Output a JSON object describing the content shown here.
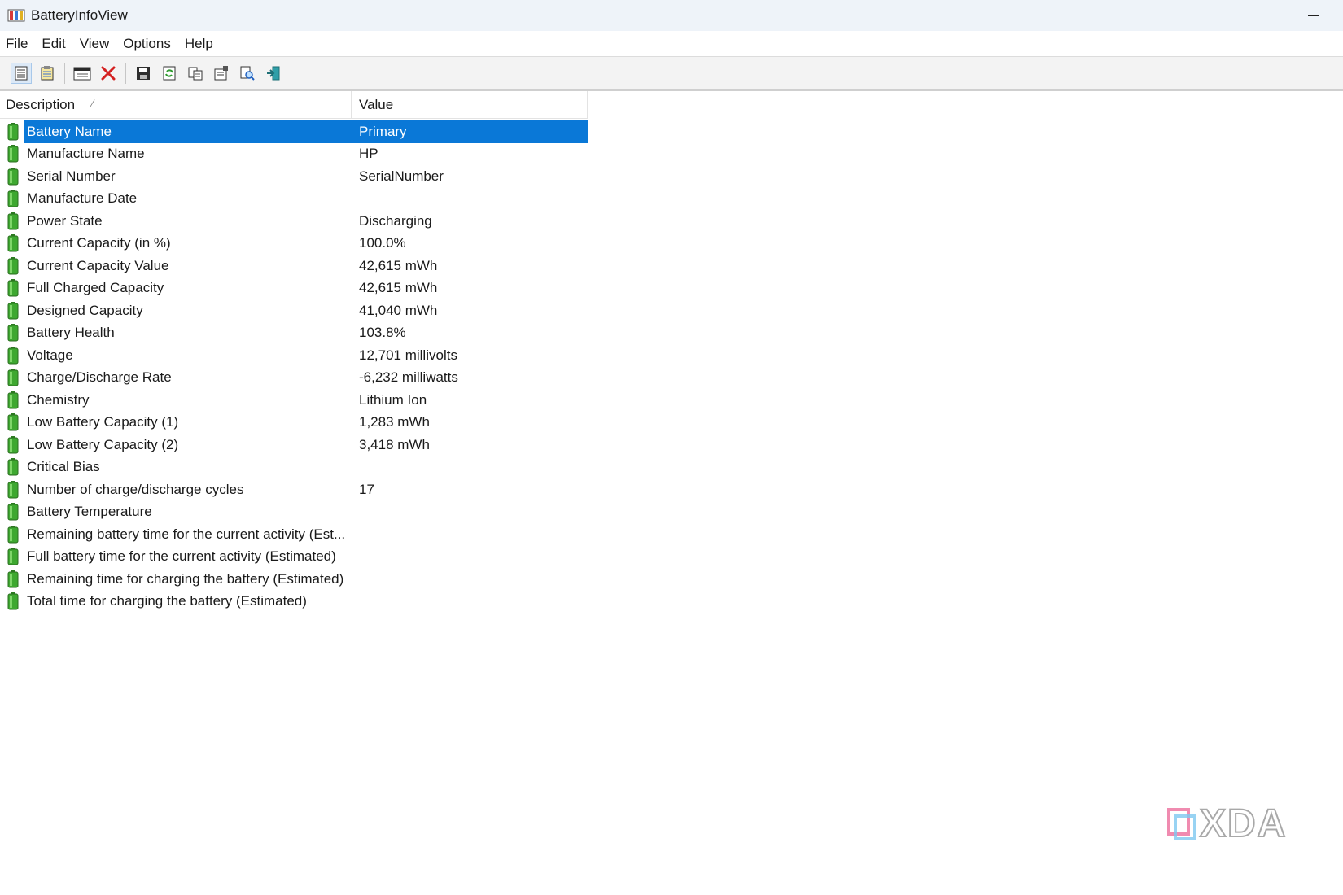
{
  "window": {
    "title": "BatteryInfoView"
  },
  "menu": [
    "File",
    "Edit",
    "View",
    "Options",
    "Help"
  ],
  "toolbar": {
    "icons": [
      "list-view-icon",
      "report-view-icon",
      "window-icon",
      "delete-icon",
      "save-icon",
      "refresh-icon",
      "copy-icon",
      "properties-icon",
      "find-icon",
      "exit-icon"
    ]
  },
  "list": {
    "columns": {
      "description": "Description",
      "value": "Value"
    },
    "sort_indicator": "⁄",
    "rows": [
      {
        "description": "Battery Name",
        "value": "Primary",
        "selected": true
      },
      {
        "description": "Manufacture Name",
        "value": "HP"
      },
      {
        "description": "Serial Number",
        "value": "SerialNumber"
      },
      {
        "description": "Manufacture Date",
        "value": ""
      },
      {
        "description": "Power State",
        "value": "Discharging"
      },
      {
        "description": "Current Capacity (in %)",
        "value": "100.0%"
      },
      {
        "description": "Current Capacity Value",
        "value": "42,615 mWh"
      },
      {
        "description": "Full Charged Capacity",
        "value": "42,615 mWh"
      },
      {
        "description": "Designed Capacity",
        "value": "41,040 mWh"
      },
      {
        "description": "Battery Health",
        "value": "103.8%"
      },
      {
        "description": "Voltage",
        "value": "12,701 millivolts"
      },
      {
        "description": "Charge/Discharge Rate",
        "value": "-6,232 milliwatts"
      },
      {
        "description": "Chemistry",
        "value": "Lithium Ion"
      },
      {
        "description": "Low Battery Capacity (1)",
        "value": "1,283 mWh"
      },
      {
        "description": "Low Battery Capacity (2)",
        "value": "3,418 mWh"
      },
      {
        "description": "Critical Bias",
        "value": ""
      },
      {
        "description": "Number of charge/discharge cycles",
        "value": "17"
      },
      {
        "description": "Battery Temperature",
        "value": ""
      },
      {
        "description": "Remaining battery time for the current activity (Est...",
        "value": ""
      },
      {
        "description": "Full battery time for the current activity (Estimated)",
        "value": ""
      },
      {
        "description": "Remaining time for charging the battery (Estimated)",
        "value": ""
      },
      {
        "description": "Total  time for charging the battery (Estimated)",
        "value": ""
      }
    ]
  },
  "watermark": "XDA",
  "colors": {
    "selection": "#0a78d7",
    "titlebar": "#eef3f9",
    "battery_icon": "#3ea830"
  }
}
